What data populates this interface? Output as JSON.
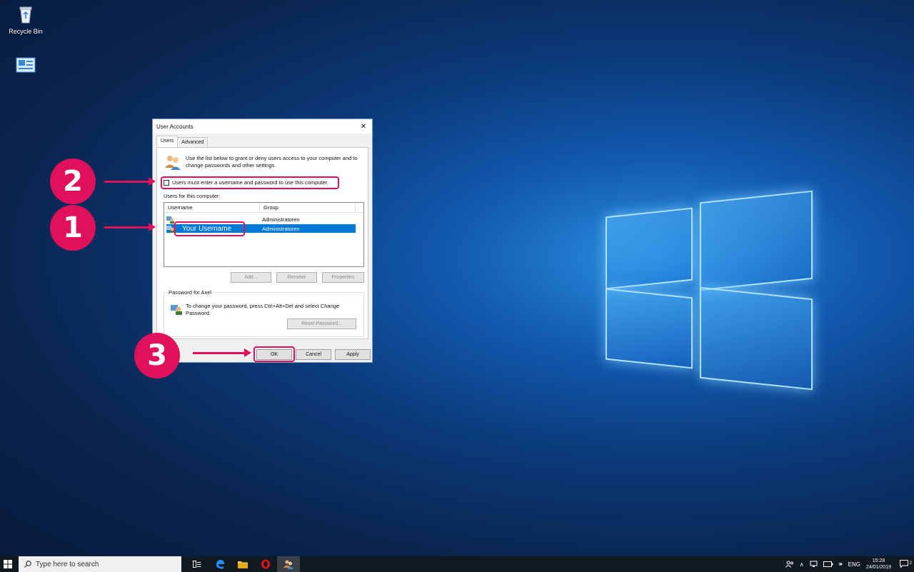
{
  "desktop": {
    "icons": [
      {
        "label": "Recycle Bin"
      },
      {
        "label": ""
      }
    ]
  },
  "dialog": {
    "title": "User Accounts",
    "close_glyph": "✕",
    "tabs": [
      {
        "label": "Users",
        "active": true
      },
      {
        "label": "Advanced",
        "active": false
      }
    ],
    "intro_text": "Use the list below to grant or deny users access to your computer and to change passwords and other settings.",
    "require_login_label": "Users must enter a username and password to use this computer.",
    "require_login_checked": false,
    "users_label": "Users for this computer:",
    "columns": [
      "Username",
      "Group"
    ],
    "users": [
      {
        "username": "",
        "group": "Administratoren",
        "selected": false
      },
      {
        "username": "Your Username",
        "group": "Administratoren",
        "selected": true
      }
    ],
    "list_buttons": {
      "add": "Add...",
      "remove": "Remove",
      "properties": "Properties"
    },
    "password_group_label": "Password for Axel",
    "password_text": "To change your password, press Ctrl+Alt+Del and select Change Password.",
    "reset_password_label": "Reset Password...",
    "ok_label": "OK",
    "cancel_label": "Cancel",
    "apply_label": "Apply"
  },
  "annotations": [
    "2",
    "1",
    "3"
  ],
  "taskbar": {
    "search_placeholder": "Type here to search",
    "language": "ENG",
    "time": "15:28",
    "date": "24/01/2019",
    "notification_count": "2"
  },
  "colors": {
    "accent": "#e0105a",
    "selection": "#0078d7"
  }
}
